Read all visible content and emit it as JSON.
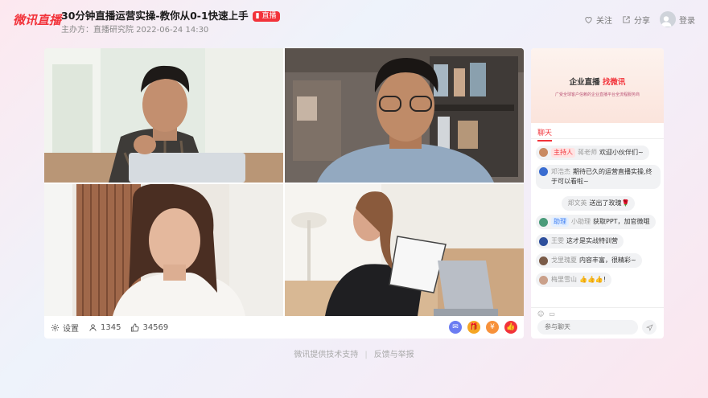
{
  "header": {
    "brand": "微讯直播",
    "title": "30分钟直播运营实操-教你从0-1快速上手",
    "live_badge": "直播",
    "host_info": "主办方：直播研究院  2022-06-24 14:30",
    "follow": "关注",
    "share": "分享",
    "login": "登录"
  },
  "video": {
    "settings": "设置",
    "viewers": "1345",
    "likes": "34569",
    "colors": {
      "accent": "#f2333a"
    }
  },
  "chat": {
    "banner_title": "企业直播",
    "banner_highlight": "找微讯",
    "banner_sub": "广受全球客户信赖的企业直播平台全流程服务商",
    "tab": "聊天",
    "messages": [
      {
        "role": "主持人",
        "role_type": "red",
        "name": "蒋老师",
        "text": "欢迎小伙伴们~"
      },
      {
        "name": "邓浩杰",
        "text": "期待已久的运营直播实操,终于可以看啦~"
      },
      {
        "gift": true,
        "name": "郑文英",
        "text": "送出了玫瑰"
      },
      {
        "role": "助理",
        "role_type": "blue",
        "name": "小助理",
        "text": "获取PPT，加官微哦"
      },
      {
        "name": "王雯",
        "text": "这才是实战特训营"
      },
      {
        "name": "戈里瑰夏",
        "text": "内容丰富，很精彩~"
      },
      {
        "name": "梅里雪山",
        "text": "👍👍👍!"
      }
    ],
    "input_placeholder": "参与聊天"
  },
  "footer": {
    "support": "微讯提供技术支持",
    "report": "反馈与举报"
  }
}
